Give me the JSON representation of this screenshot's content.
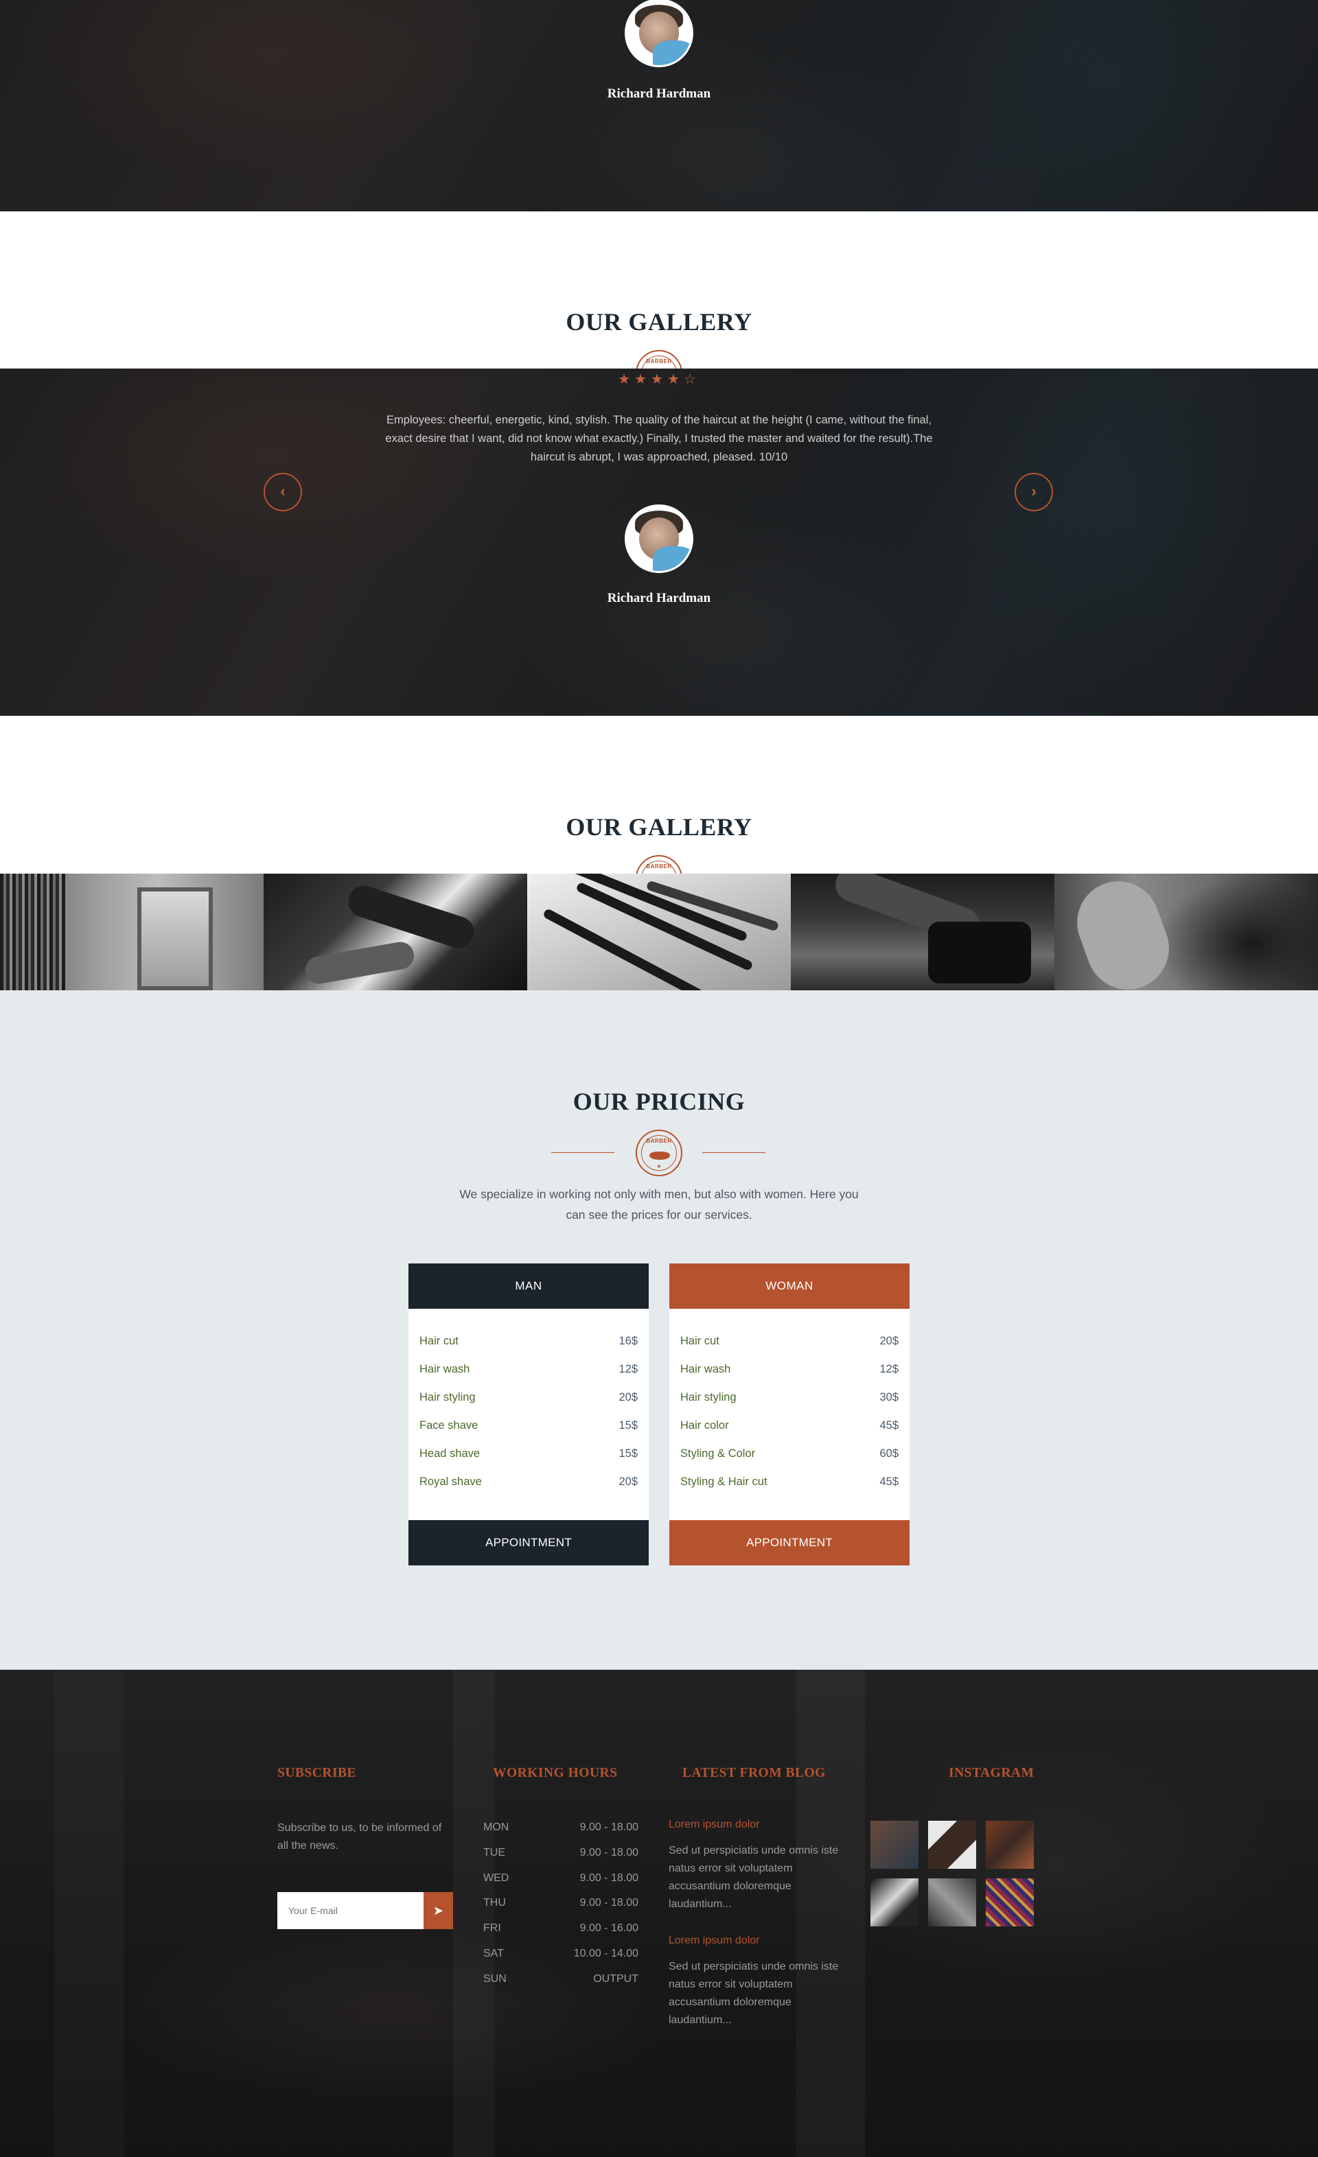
{
  "testimonial_top": {
    "name": "Richard Hardman"
  },
  "gallery_heading_1": "OUR GALLERY",
  "testimonial": {
    "stars": "★★★★☆",
    "quote": "Employees: cheerful, energetic, kind, stylish. The quality of the haircut at the height (I came, without the final, exact desire that I want, did not know what exactly.) Finally, I trusted the master and waited for the result).The haircut is abrupt, I was approached, pleased. 10/10",
    "name": "Richard Hardman",
    "prev_icon": "chevron-left-icon",
    "next_icon": "chevron-right-icon"
  },
  "gallery": {
    "title": "OUR GALLERY"
  },
  "pricing": {
    "title": "OUR PRICING",
    "intro": "We specialize in working not only with men, but also with women. Here you can see the prices for our services.",
    "accent_color": "#b5532f",
    "dark_color": "#1b232b",
    "plans": [
      {
        "title": "MAN",
        "items": [
          {
            "name": "Hair cut",
            "price": "16$"
          },
          {
            "name": "Hair wash",
            "price": "12$"
          },
          {
            "name": "Hair styling",
            "price": "20$"
          },
          {
            "name": "Face shave",
            "price": "15$"
          },
          {
            "name": "Head shave",
            "price": "15$"
          },
          {
            "name": "Royal shave",
            "price": "20$"
          }
        ],
        "button": "APPOINTMENT"
      },
      {
        "title": "WOMAN",
        "items": [
          {
            "name": "Hair cut",
            "price": "20$"
          },
          {
            "name": "Hair wash",
            "price": "12$"
          },
          {
            "name": "Hair styling",
            "price": "30$"
          },
          {
            "name": "Hair color",
            "price": "45$"
          },
          {
            "name": "Styling & Color",
            "price": "60$"
          },
          {
            "name": "Styling & Hair cut",
            "price": "45$"
          }
        ],
        "button": "APPOINTMENT"
      }
    ]
  },
  "footer": {
    "subscribe": {
      "title": "SUBSCRIBE",
      "text": "Subscribe to us, to be informed of all the news.",
      "placeholder": "Your E-mail",
      "send_icon": "paper-plane-icon"
    },
    "hours": {
      "title": "WORKING HOURS",
      "rows": [
        {
          "day": "MON",
          "time": "9.00 - 18.00"
        },
        {
          "day": "TUE",
          "time": "9.00 - 18.00"
        },
        {
          "day": "WED",
          "time": "9.00 - 18.00"
        },
        {
          "day": "THU",
          "time": "9.00 - 18.00"
        },
        {
          "day": "FRI",
          "time": "9.00 - 16.00"
        },
        {
          "day": "SAT",
          "time": "10.00 - 14.00"
        },
        {
          "day": "SUN",
          "time": "OUTPUT"
        }
      ]
    },
    "blog": {
      "title": "LATEST FROM BLOG",
      "posts": [
        {
          "title": "Lorem ipsum dolor",
          "excerpt": "Sed ut perspiciatis unde omnis iste natus error sit voluptatem accusantium doloremque laudantium..."
        },
        {
          "title": "Lorem ipsum dolor",
          "excerpt": "Sed ut perspiciatis unde omnis iste natus error sit voluptatem accusantium doloremque laudantium..."
        }
      ]
    },
    "instagram": {
      "title": "INSTAGRAM"
    }
  }
}
